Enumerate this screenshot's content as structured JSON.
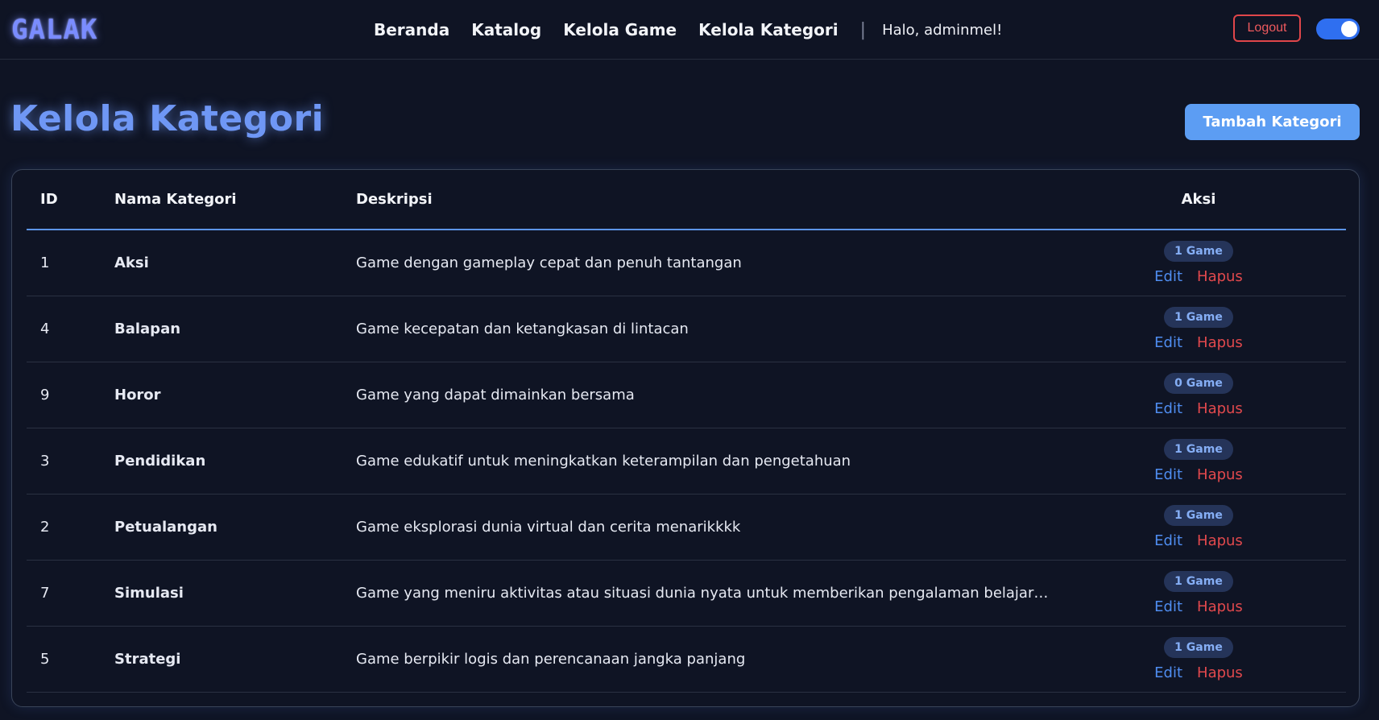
{
  "brand": "GALAK",
  "nav": {
    "items": [
      "Beranda",
      "Katalog",
      "Kelola Game",
      "Kelola Kategori"
    ],
    "separator": "|",
    "greeting": "Halo, adminmel!"
  },
  "logout_label": "Logout",
  "theme_toggle": {
    "on": true,
    "accent": "#2f6ff0"
  },
  "page_title": "Kelola Kategori",
  "add_button_label": "Tambah Kategori",
  "table": {
    "headers": {
      "id": "ID",
      "name": "Nama Kategori",
      "desc": "Deskripsi",
      "action": "Aksi"
    },
    "edit_label": "Edit",
    "delete_label": "Hapus",
    "rows": [
      {
        "id": "1",
        "name": "Aksi",
        "desc": "Game dengan gameplay cepat dan penuh tantangan",
        "count": "1 Game"
      },
      {
        "id": "4",
        "name": "Balapan",
        "desc": "Game kecepatan dan ketangkasan di lintacan",
        "count": "1 Game"
      },
      {
        "id": "9",
        "name": "Horor",
        "desc": "Game yang dapat dimainkan bersama",
        "count": "0 Game"
      },
      {
        "id": "3",
        "name": "Pendidikan",
        "desc": "Game edukatif untuk meningkatkan keterampilan dan pengetahuan",
        "count": "1 Game"
      },
      {
        "id": "2",
        "name": "Petualangan",
        "desc": "Game eksplorasi dunia virtual dan cerita menarikkkk",
        "count": "1 Game"
      },
      {
        "id": "7",
        "name": "Simulasi",
        "desc": "Game yang meniru aktivitas atau situasi dunia nyata untuk memberikan pengalaman belajar, eks...",
        "count": "1 Game"
      },
      {
        "id": "5",
        "name": "Strategi",
        "desc": "Game berpikir logis dan perencanaan jangka panjang",
        "count": "1 Game"
      }
    ]
  },
  "colors": {
    "background": "#0f1424",
    "accent_blue": "#5c9df3",
    "danger": "#e2494d"
  }
}
